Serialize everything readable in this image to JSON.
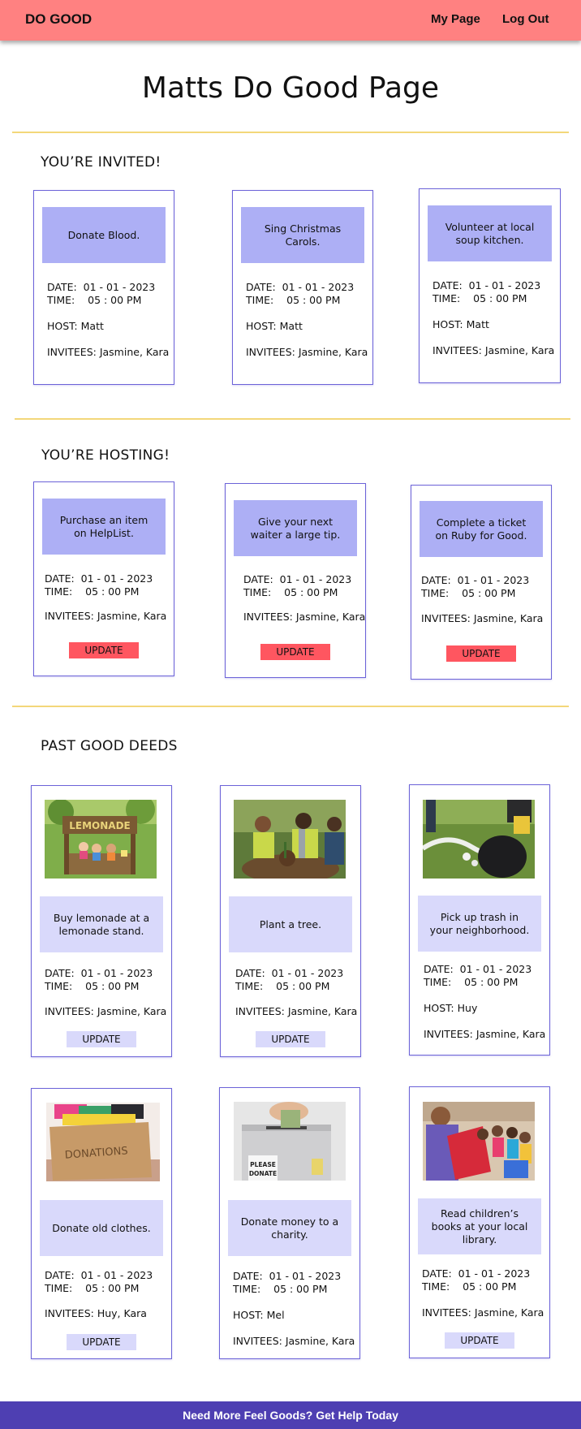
{
  "nav": {
    "brand": "DO GOOD",
    "my_page": "My Page",
    "log_out": "Log Out"
  },
  "page_title": "Matts Do Good Page",
  "invited": {
    "title": "YOU’RE INVITED!",
    "cards": [
      {
        "title": "Donate Blood.",
        "date": "DATE:  01 - 01 - 2023",
        "time": "TIME:    05 : 00 PM",
        "host": "HOST: Matt",
        "invitees": "INVITEES: Jasmine, Kara"
      },
      {
        "title": "Sing Christmas Carols.",
        "date": "DATE:  01 - 01 - 2023",
        "time": "TIME:    05 : 00 PM",
        "host": "HOST: Matt",
        "invitees": "INVITEES: Jasmine, Kara"
      },
      {
        "title": "Volunteer at local soup kitchen.",
        "date": "DATE:  01 - 01 - 2023",
        "time": "TIME:    05 : 00 PM",
        "host": "HOST: Matt",
        "invitees": "INVITEES: Jasmine, Kara"
      }
    ]
  },
  "hosting": {
    "title": "YOU’RE HOSTING!",
    "cards": [
      {
        "title": "Purchase an item on HelpList.",
        "date": "DATE:  01 - 01 - 2023",
        "time": "TIME:    05 : 00 PM",
        "invitees": "INVITEES: Jasmine, Kara",
        "button": "UPDATE"
      },
      {
        "title": "Give your next waiter a large tip.",
        "date": "DATE:  01 - 01 - 2023",
        "time": "TIME:    05 : 00 PM",
        "invitees": "INVITEES: Jasmine, Kara",
        "button": "UPDATE"
      },
      {
        "title": "Complete a ticket on Ruby for Good.",
        "date": "DATE:  01 - 01 - 2023",
        "time": "TIME:    05 : 00 PM",
        "invitees": "INVITEES: Jasmine, Kara",
        "button": "UPDATE"
      }
    ]
  },
  "past": {
    "title": "PAST GOOD DEEDS",
    "cards": [
      {
        "image": "lemonade-stand-photo",
        "image_text": "LEMONADE",
        "title": "Buy lemonade at a lemonade stand.",
        "date": "DATE:  01 - 01 - 2023",
        "time": "TIME:    05 : 00 PM",
        "invitees": "INVITEES: Jasmine, Kara",
        "button": "UPDATE"
      },
      {
        "image": "tree-planting-photo",
        "title": "Plant a tree.",
        "date": "DATE:  01 - 01 - 2023",
        "time": "TIME:    05 : 00 PM",
        "invitees": "INVITEES: Jasmine, Kara",
        "button": "UPDATE"
      },
      {
        "image": "trash-pickup-photo",
        "title": "Pick up trash in your neighborhood.",
        "date": "DATE:  01 - 01 - 2023",
        "time": "TIME:    05 : 00 PM",
        "host": "HOST: Huy",
        "invitees": "INVITEES: Jasmine, Kara"
      },
      {
        "image": "donations-box-photo",
        "image_text": "DONATIONS",
        "title": "Donate old clothes.",
        "date": "DATE:  01 - 01 - 2023",
        "time": "TIME:    05 : 00 PM",
        "invitees": "INVITEES: Huy, Kara",
        "button": "UPDATE"
      },
      {
        "image": "donation-box-photo",
        "image_text": [
          "PLEASE",
          "DONATE"
        ],
        "title": "Donate money to a charity.",
        "date": "DATE:  01 - 01 - 2023",
        "time": "TIME:    05 : 00 PM",
        "host": "HOST: Mel",
        "invitees": "INVITEES: Jasmine, Kara"
      },
      {
        "image": "reading-to-children-photo",
        "title": "Read children’s books at your local library.",
        "date": "DATE:  01 - 01 - 2023",
        "time": "TIME:    05 : 00 PM",
        "invitees": "INVITEES: Jasmine, Kara",
        "button": "UPDATE"
      }
    ]
  },
  "footer": "Need More Feel Goods? Get Help Today",
  "colors": {
    "navbar": "#ff8181",
    "card_border": "#6c63d8",
    "header_strong": "#adaff5",
    "header_soft": "#d9d9fb",
    "update_red": "#ff5660",
    "divider": "#f3d77a",
    "footer": "#4e3fb2"
  }
}
